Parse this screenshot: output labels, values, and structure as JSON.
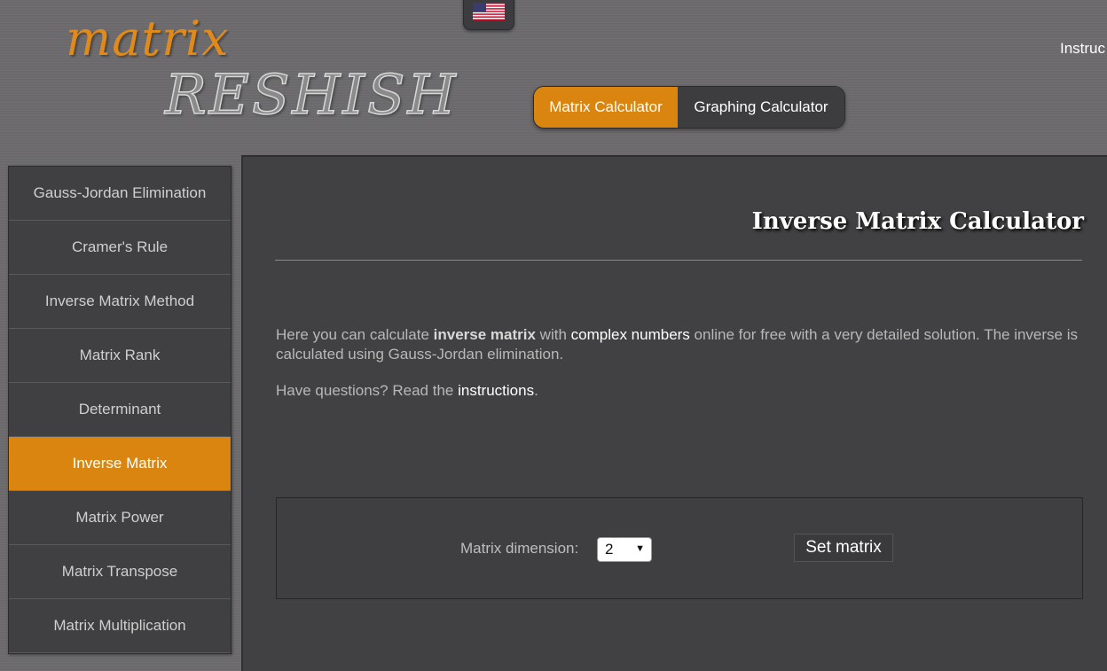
{
  "logo": {
    "top": "matrix",
    "bottom": "RESHISH"
  },
  "header": {
    "language_icon": "us-flag-icon",
    "top_link": "Instruc",
    "calc_switch": {
      "active": "Matrix Calculator",
      "inactive": "Graphing Calculator"
    }
  },
  "sidebar": {
    "items": [
      {
        "label": "Gauss-Jordan Elimination",
        "active": false
      },
      {
        "label": "Cramer's Rule",
        "active": false
      },
      {
        "label": "Inverse Matrix Method",
        "active": false
      },
      {
        "label": "Matrix Rank",
        "active": false
      },
      {
        "label": "Determinant",
        "active": false
      },
      {
        "label": "Inverse Matrix",
        "active": true
      },
      {
        "label": "Matrix Power",
        "active": false
      },
      {
        "label": "Matrix Transpose",
        "active": false
      },
      {
        "label": "Matrix Multiplication",
        "active": false
      }
    ]
  },
  "main": {
    "title": "Inverse Matrix Calculator",
    "intro": {
      "p1_a": "Here you can calculate ",
      "p1_b": "inverse matrix",
      "p1_c": " with ",
      "p1_link": "complex numbers",
      "p1_d": " online for free with a very detailed solution. The inverse is calculated using Gauss-Jordan elimination.",
      "p2_a": "Have questions? Read the ",
      "p2_link": "instructions",
      "p2_b": "."
    },
    "settings": {
      "dimension_label": "Matrix dimension:",
      "dimension_value": "2",
      "set_button": "Set matrix"
    }
  },
  "colors": {
    "accent": "#d98510",
    "panel": "#414042",
    "background": "#6c6a6d"
  }
}
